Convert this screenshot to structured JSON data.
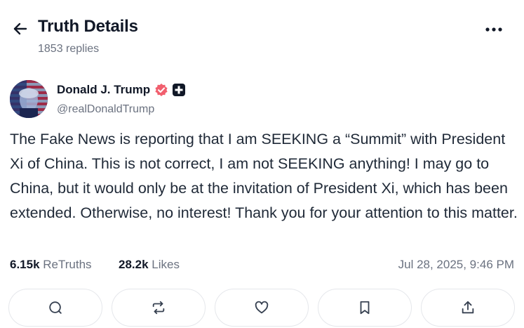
{
  "header": {
    "title": "Truth Details",
    "replies": "1853 replies",
    "back_icon": "arrow-left-icon",
    "more_icon": "more-horizontal-icon"
  },
  "author": {
    "name": "Donald J. Trump",
    "handle": "@realDonaldTrump",
    "verified_color": "#f15f6e"
  },
  "post": {
    "text": "The Fake News is reporting that I am SEEKING a “Summit” with President Xi of China. This is not correct, I am not SEEKING anything! I may go to China, but it would only be at the invitation of President Xi, which has been extended. Otherwise, no interest! Thank you for your attention to this matter."
  },
  "stats": {
    "retruths_count": "6.15k",
    "retruths_label": "ReTruths",
    "likes_count": "28.2k",
    "likes_label": "Likes",
    "timestamp": "Jul 28, 2025, 9:46 PM"
  },
  "actions": [
    "comment-icon",
    "retruth-icon",
    "heart-icon",
    "bookmark-icon",
    "share-icon"
  ]
}
